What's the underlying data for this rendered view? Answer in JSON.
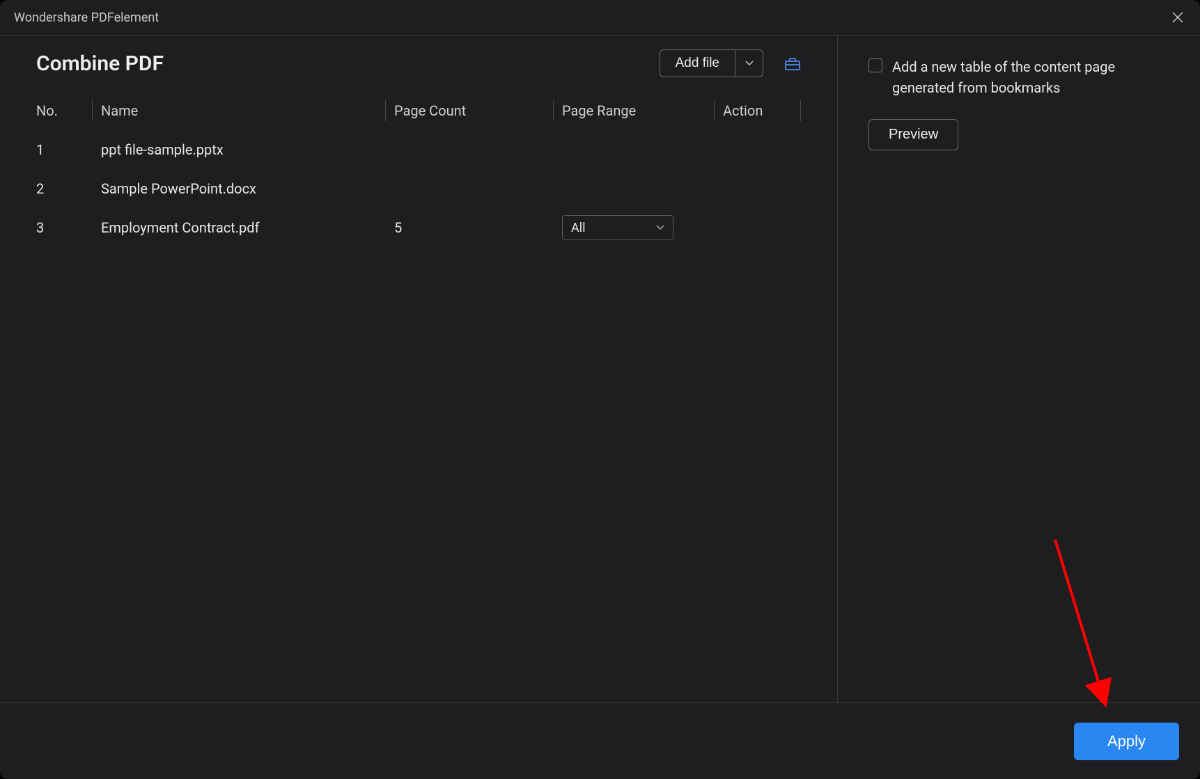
{
  "titlebar": {
    "app_name": "Wondershare PDFelement"
  },
  "main": {
    "page_title": "Combine PDF",
    "add_file_label": "Add file",
    "columns": {
      "no": "No.",
      "name": "Name",
      "page_count": "Page Count",
      "page_range": "Page Range",
      "action": "Action"
    },
    "rows": [
      {
        "no": "1",
        "name": "ppt file-sample.pptx",
        "page_count": "",
        "page_range": ""
      },
      {
        "no": "2",
        "name": "Sample PowerPoint.docx",
        "page_count": "",
        "page_range": ""
      },
      {
        "no": "3",
        "name": "Employment Contract.pdf",
        "page_count": "5",
        "page_range": "All"
      }
    ]
  },
  "side": {
    "toc_checkbox_label": "Add a new table of the content page generated from bookmarks",
    "toc_checked": false,
    "preview_label": "Preview"
  },
  "footer": {
    "apply_label": "Apply"
  }
}
